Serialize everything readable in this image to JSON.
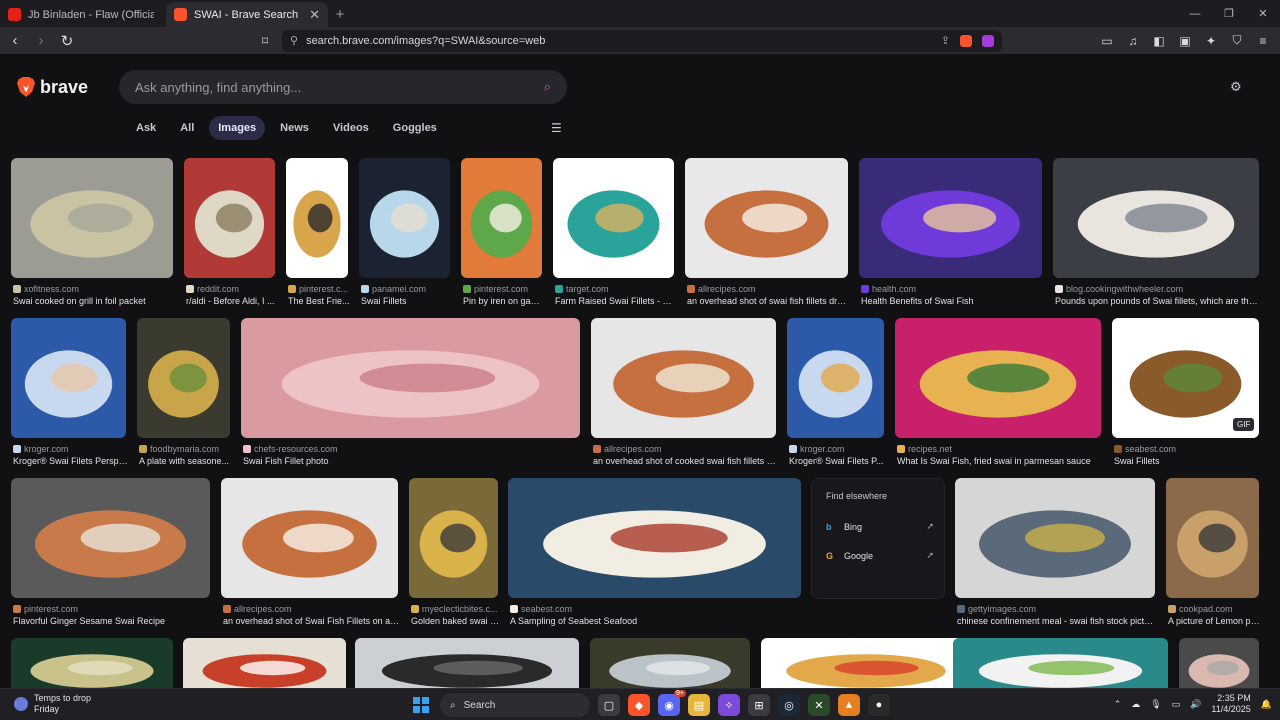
{
  "tabs": [
    {
      "title": "Jb Binladen - Flaw (Official Music Vid",
      "favicon_color": "#e62117"
    },
    {
      "title": "SWAI - Brave Search",
      "favicon_color": "#fb542b"
    }
  ],
  "toolbar": {
    "url": "search.brave.com/images?q=SWAI&source=web"
  },
  "search": {
    "placeholder": "Ask anything, find anything..."
  },
  "logo": {
    "text": "brave"
  },
  "nav": [
    "Ask",
    "All",
    "Images",
    "News",
    "Videos",
    "Goggles"
  ],
  "active_nav": "Images",
  "rows": [
    [
      {
        "source": "xofitness.com",
        "caption": "Swai cooked on grill in foil packet",
        "palette": [
          "#9c9c95",
          "#c9c3a4",
          "#a8a899"
        ]
      },
      {
        "source": "reddit.com",
        "caption": "r/aldi - Before Aldi, I ...",
        "palette": [
          "#b13a36",
          "#e0d8c6",
          "#8a7c5c"
        ]
      },
      {
        "source": "pinterest.c...",
        "caption": "The Best Frie...",
        "palette": [
          "#ffffff",
          "#d9a54a",
          "#2a2a2a"
        ]
      },
      {
        "source": "panamei.com",
        "caption": "Swai Fillets",
        "palette": [
          "#1b2231",
          "#b8d7ea",
          "#e6dfd0"
        ]
      },
      {
        "source": "pinterest.com",
        "caption": "Pin by iren on gast...",
        "palette": [
          "#e27b3a",
          "#5fa84a",
          "#f4efe3"
        ]
      },
      {
        "source": "target.com",
        "caption": "Farm Raised Swai Fillets - Fro...",
        "palette": [
          "#ffffff",
          "#2aa39b",
          "#d9b05f"
        ]
      },
      {
        "source": "allrecipes.com",
        "caption": "an overhead shot of swai fish fillets dres...",
        "palette": [
          "#e8e8e8",
          "#c6703f",
          "#f6f3ea"
        ]
      },
      {
        "source": "health.com",
        "caption": "Health Benefits of Swai Fish",
        "palette": [
          "#3a2a7a",
          "#6e3ad9",
          "#e8c79a"
        ]
      },
      {
        "source": "blog.cookingwithwheeler.com",
        "caption": "Pounds upon pounds of Swai fillets, which are the si...",
        "palette": [
          "#3b3f45",
          "#e9e4dd",
          "#7d8591"
        ]
      }
    ],
    [
      {
        "source": "kroger.com",
        "caption": "Kroger® Swai Filets Perspe...",
        "palette": [
          "#2d5aa8",
          "#c8d9ef",
          "#e7c6a8"
        ]
      },
      {
        "source": "foodbymaria.com",
        "caption": "A plate with seasone...",
        "palette": [
          "#3a3a2f",
          "#c9a54a",
          "#6a8f3a"
        ]
      },
      {
        "source": "chefs-resources.com",
        "caption": "Swai Fish Fillet photo",
        "palette": [
          "#d99aa0",
          "#eec3c6",
          "#c97e88"
        ]
      },
      {
        "source": "allrecipes.com",
        "caption": "an overhead shot of cooked swai fish fillets wi...",
        "palette": [
          "#e6e6e6",
          "#c6703f",
          "#f0ead8"
        ]
      },
      {
        "source": "kroger.com",
        "caption": "Kroger® Swai Filets P...",
        "palette": [
          "#2d5aa8",
          "#c8d9ef",
          "#e2a84a"
        ]
      },
      {
        "source": "recipes.net",
        "caption": "What Is Swai Fish, fried swai in parmesan sauce",
        "palette": [
          "#c8206b",
          "#e7b24f",
          "#3a7a3a"
        ]
      },
      {
        "source": "seabest.com",
        "caption": "Swai Fillets",
        "gif": "GIF",
        "palette": [
          "#ffffff",
          "#8b5a2b",
          "#5a8a3a"
        ]
      }
    ],
    [
      {
        "source": "pinterest.com",
        "caption": "Flavorful Ginger Sesame Swai Recipe",
        "palette": [
          "#5a5a5a",
          "#c97a4a",
          "#e9e4da"
        ]
      },
      {
        "source": "allrecipes.com",
        "caption": "an overhead shot of Swai Fish Fillets on an ...",
        "palette": [
          "#e6e6e6",
          "#c6703f",
          "#f7f3ea"
        ]
      },
      {
        "source": "myeclecticbites.c...",
        "caption": "Golden baked swai f...",
        "palette": [
          "#7a6a3a",
          "#d9b24a",
          "#3a3a3a"
        ]
      },
      {
        "source": "seabest.com",
        "caption": "A Sampling of Seabest Seafood",
        "palette": [
          "#2a4a6a",
          "#f2ede2",
          "#a83a2a"
        ]
      },
      {
        "source": "gettyimages.com",
        "caption": "chinese confinement meal - swai fish stock pictur...",
        "palette": [
          "#d6d6d6",
          "#5a6a7a",
          "#c9b04a"
        ]
      },
      {
        "source": "cookpad.com",
        "caption": "A picture of Lemon pe...",
        "palette": [
          "#8a6a4a",
          "#c9a06a",
          "#3a3a3a"
        ]
      }
    ],
    [
      {
        "palette": [
          "#1a3a2a",
          "#c9c28a",
          "#e6e0c0"
        ]
      },
      {
        "palette": [
          "#e6e0d4",
          "#c9402a",
          "#ffffff"
        ]
      },
      {
        "palette": [
          "#ccd0d4",
          "#2a2a2a",
          "#6a6a6a"
        ]
      },
      {
        "palette": [
          "#3a3a2a",
          "#b9c3c8",
          "#e6e8ea"
        ]
      },
      {
        "palette": [
          "#ffffff",
          "#e2a84a",
          "#d9402a"
        ]
      },
      {
        "palette": [
          "#2a8a8a",
          "#f2f2f2",
          "#7ab84a"
        ]
      },
      {
        "palette": [
          "#4a4a4a",
          "#d9b8b0",
          "#a8a8a8"
        ]
      }
    ]
  ],
  "find_elsewhere": {
    "title": "Find elsewhere",
    "engines": [
      "Bing",
      "Google"
    ]
  },
  "taskbar": {
    "weather_title": "Temps to drop",
    "weather_sub": "Friday",
    "search_label": "Search",
    "time": "2:35 PM",
    "date": "11/4/2025",
    "badge": "9+"
  }
}
